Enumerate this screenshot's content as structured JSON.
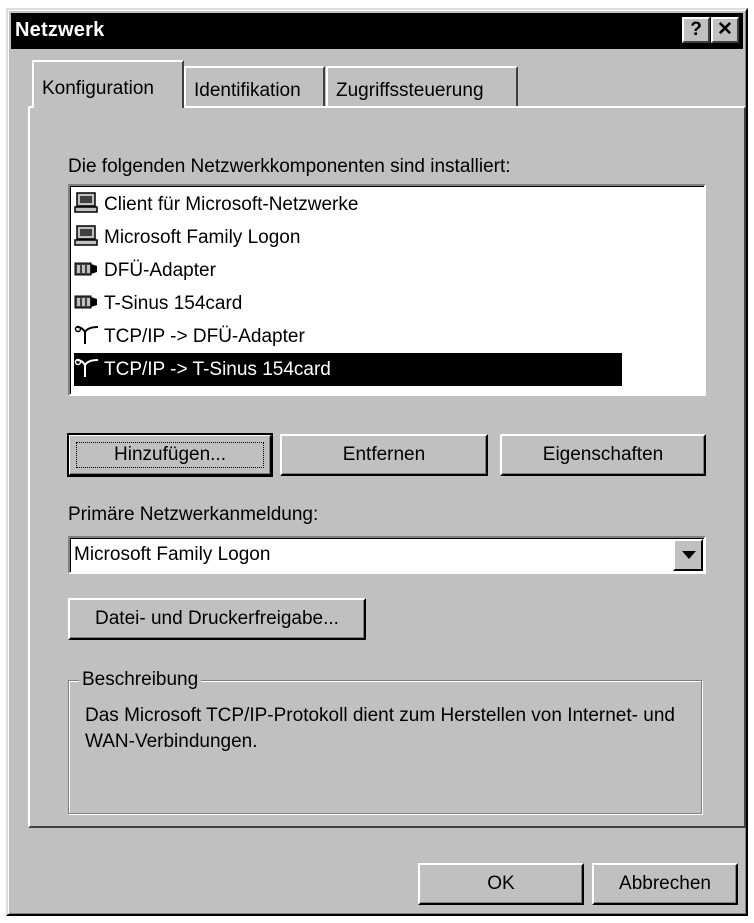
{
  "window": {
    "title": "Netzwerk",
    "help_glyph": "?",
    "close_glyph": "✕"
  },
  "tabs": [
    {
      "label": "Konfiguration",
      "active": true
    },
    {
      "label": "Identifikation",
      "active": false
    },
    {
      "label": "Zugriffssteuerung",
      "active": false
    }
  ],
  "components": {
    "label": "Die folgenden Netzwerkkomponenten sind installiert:",
    "items": [
      {
        "label": "Client für Microsoft-Netzwerke",
        "icon": "client-icon",
        "selected": false
      },
      {
        "label": "Microsoft Family Logon",
        "icon": "client-icon",
        "selected": false
      },
      {
        "label": "DFÜ-Adapter",
        "icon": "network-adapter-icon",
        "selected": false
      },
      {
        "label": "T-Sinus 154card",
        "icon": "network-adapter-icon",
        "selected": false
      },
      {
        "label": "TCP/IP -> DFÜ-Adapter",
        "icon": "protocol-icon",
        "selected": false
      },
      {
        "label": "TCP/IP -> T-Sinus 154card",
        "icon": "protocol-icon",
        "selected": true
      }
    ]
  },
  "buttons": {
    "add": "Hinzufügen...",
    "remove": "Entfernen",
    "properties": "Eigenschaften",
    "file_print_sharing": "Datei- und Druckerfreigabe...",
    "ok": "OK",
    "cancel": "Abbrechen"
  },
  "primary_logon": {
    "label": "Primäre Netzwerkanmeldung:",
    "value": "Microsoft Family Logon"
  },
  "description": {
    "legend": "Beschreibung",
    "text": "Das Microsoft TCP/IP-Protokoll dient zum Herstellen von Internet- und WAN-Verbindungen."
  }
}
